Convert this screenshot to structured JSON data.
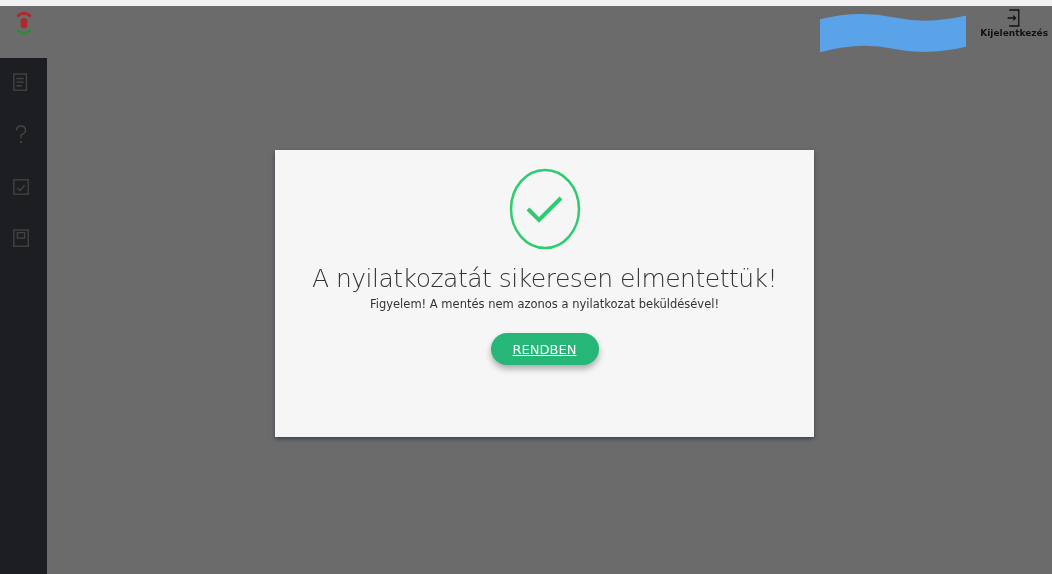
{
  "header": {
    "logout": {
      "label": "Kijelentkezés"
    }
  },
  "dialog": {
    "title": "A nyilatkozatát sikeresen elmentettük!",
    "message": "Figyelem! A mentés nem azonos a nyilatkozat beküldésével!",
    "button": "RENDBEN"
  }
}
